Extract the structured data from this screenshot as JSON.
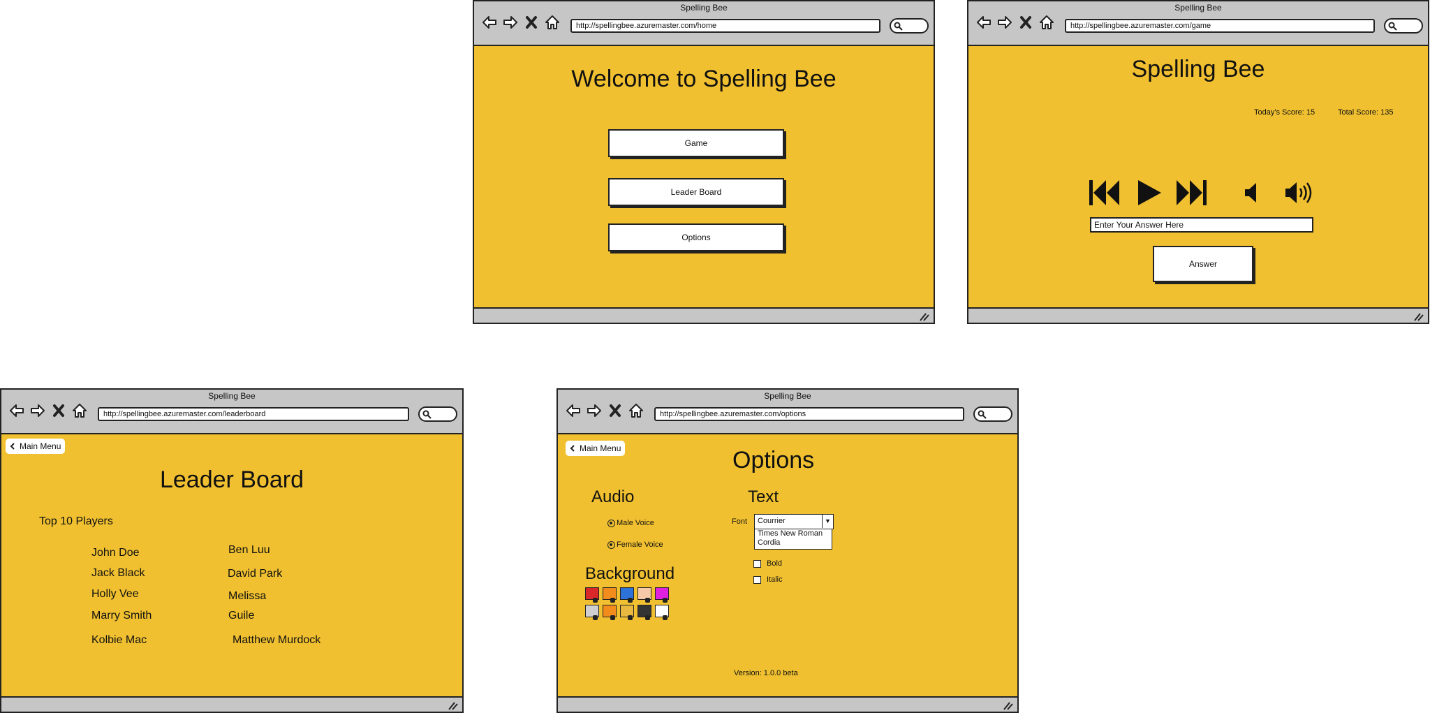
{
  "screens": {
    "home": {
      "window_title": "Spelling Bee",
      "url": "http://spellingbee.azuremaster.com/home",
      "heading": "Welcome to Spelling Bee",
      "buttons": {
        "game": "Game",
        "leaderboard": "Leader Board",
        "options": "Options"
      }
    },
    "game": {
      "window_title": "Spelling Bee",
      "url": "http://spellingbee.azuremaster.com/game",
      "heading": "Spelling Bee",
      "todays_score": "Today's Score: 15",
      "total_score": "Total Score: 135",
      "answer_placeholder": "Enter Your Answer Here",
      "answer_button": "Answer",
      "media_icons": [
        "skip-back-icon",
        "play-icon",
        "skip-forward-icon",
        "volume-low-icon",
        "volume-high-icon"
      ]
    },
    "leaderboard": {
      "window_title": "Spelling Bee",
      "url": "http://spellingbee.azuremaster.com/leaderboard",
      "back_label": "Main Menu",
      "heading": "Leader Board",
      "subheading": "Top 10 Players",
      "players_left": [
        "John Doe",
        "Jack Black",
        "Holly Vee",
        "Marry Smith",
        "Kolbie Mac"
      ],
      "players_right": [
        "Ben Luu",
        "David Park",
        "Melissa",
        "Guile",
        "Matthew Murdock"
      ]
    },
    "options": {
      "window_title": "Spelling Bee",
      "url": "http://spellingbee.azuremaster.com/options",
      "back_label": "Main Menu",
      "heading": "Options",
      "audio": {
        "label": "Audio",
        "male": "Male Voice",
        "female": "Female Voice"
      },
      "text": {
        "label": "Text",
        "font_label": "Font",
        "font_selected": "Courrier",
        "font_options": [
          "Times New Roman",
          "Cordia"
        ],
        "bold": "Bold",
        "italic": "Italic"
      },
      "background": {
        "label": "Background",
        "colors": [
          "#d8282a",
          "#f28c1c",
          "#2c72d8",
          "#f6c9a8",
          "#e020e0",
          "#cfcfcf",
          "#f28c1c",
          "#e8b840",
          "#333333",
          "#ffffff"
        ]
      },
      "version": "Version: 1.0.0 beta"
    }
  }
}
